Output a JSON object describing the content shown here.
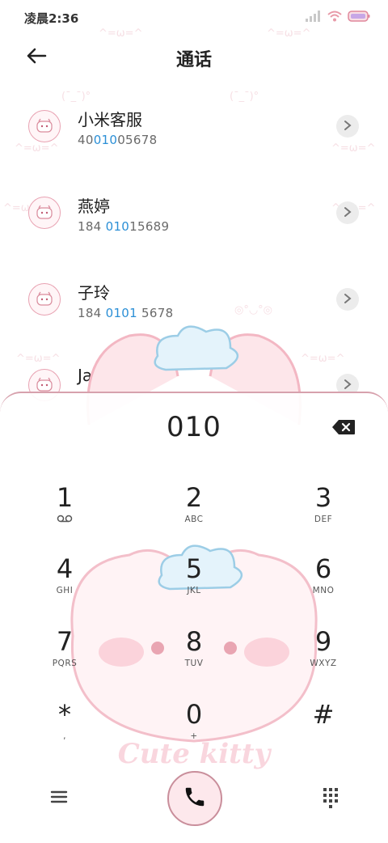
{
  "status": {
    "time": "凌晨2:36"
  },
  "header": {
    "title": "通话"
  },
  "contacts": [
    {
      "name": "小米客服",
      "num_pre": "40",
      "num_hl": "010",
      "num_post": "05678"
    },
    {
      "name": "燕婷",
      "num_pre": "184 ",
      "num_hl": "010",
      "num_post": "15689"
    },
    {
      "name": "子玲",
      "num_pre": "184 ",
      "num_hl": "0101",
      "num_post": " 5678"
    },
    {
      "name": "Jason",
      "num_pre": "",
      "num_hl": "",
      "num_post": ""
    }
  ],
  "dialer": {
    "display": "010",
    "keys": [
      {
        "digit": "1",
        "letters": ""
      },
      {
        "digit": "2",
        "letters": "ABC"
      },
      {
        "digit": "3",
        "letters": "DEF"
      },
      {
        "digit": "4",
        "letters": "GHI"
      },
      {
        "digit": "5",
        "letters": "JKL"
      },
      {
        "digit": "6",
        "letters": "MNO"
      },
      {
        "digit": "7",
        "letters": "PQRS"
      },
      {
        "digit": "8",
        "letters": "TUV"
      },
      {
        "digit": "9",
        "letters": "WXYZ"
      },
      {
        "digit": "*",
        "letters": ","
      },
      {
        "digit": "0",
        "letters": "+"
      },
      {
        "digit": "#",
        "letters": ""
      }
    ]
  },
  "theme": {
    "brand_text": "Cute kitty",
    "accent": "#2b8fd6",
    "pink": "#e8a2b2"
  },
  "icons": [
    "back-arrow-icon",
    "signal-icon",
    "wifi-icon",
    "battery-icon",
    "chevron-right-icon",
    "backspace-icon",
    "voicemail-icon",
    "menu-icon",
    "phone-icon",
    "dialpad-icon"
  ]
}
